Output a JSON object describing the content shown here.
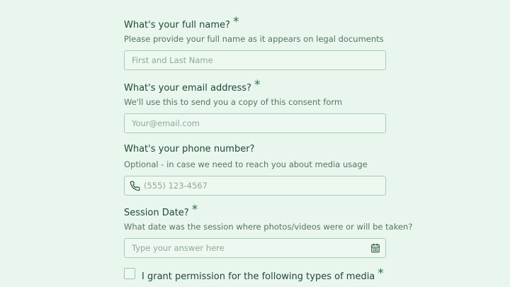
{
  "form": {
    "required_marker": "*",
    "full_name": {
      "label": "What's your full name?",
      "help": "Please provide your full name as it appears on legal documents",
      "placeholder": "First and Last Name",
      "value": ""
    },
    "email": {
      "label": "What's your email address?",
      "help": "We'll use this to send you a copy of this consent form",
      "placeholder": "Your@email.com",
      "value": ""
    },
    "phone": {
      "label": "What's your phone number?",
      "help": "Optional - in case we need to reach you about media usage",
      "placeholder": "(555) 123-4567",
      "value": "",
      "icon": "phone-icon"
    },
    "session_date": {
      "label": "Session Date?",
      "help": "What date was the session where photos/videos were or will be taken?",
      "placeholder": "Type your answer here",
      "value": "",
      "icon": "calendar-icon"
    },
    "media_permission": {
      "label": "I grant permission for the following types of media",
      "checked": false
    }
  },
  "colors": {
    "background": "#e9f6ee",
    "text": "#1f4a35",
    "help_text": "#557563",
    "input_border": "#a7cdb7",
    "placeholder": "#8fa99a"
  }
}
